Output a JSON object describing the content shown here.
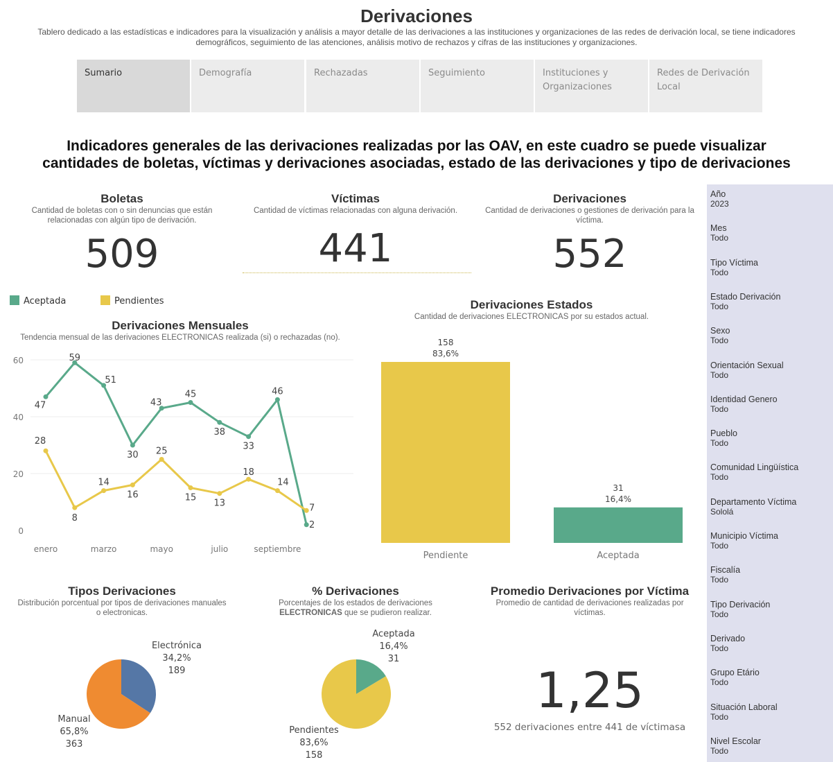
{
  "header": {
    "title": "Derivaciones",
    "subtitle_line1": "Tablero dedicado a las estadísticas e indicadores para la visualización y análisis a mayor detalle de las derivaciones a las instituciones y organizaciones de las redes de derivación local, se tiene indicadores",
    "subtitle_line2": "demográficos, seguimiento de las atenciones, análisis motivo de rechazos y cifras de las instituciones y organizaciones."
  },
  "tabs": [
    {
      "line1": "Sumario",
      "line2": "",
      "active": true
    },
    {
      "line1": "Demografía",
      "line2": ""
    },
    {
      "line1": "Rechazadas",
      "line2": ""
    },
    {
      "line1": "Seguimiento",
      "line2": ""
    },
    {
      "line1": "Instituciones y",
      "line2": "Organizaciones"
    },
    {
      "line1": "Redes de Derivación",
      "line2": "Local"
    }
  ],
  "section_heading": {
    "line1": "Indicadores generales de las derivaciones realizadas por las OAV, en este cuadro se puede visualizar",
    "line2": "cantidades de boletas, víctimas y derivaciones asociadas, estado de las derivaciones y tipo de derivaciones"
  },
  "kpis": {
    "boletas": {
      "title": "Boletas",
      "sub1": "Cantidad de boletas con o sin denuncias que están",
      "sub2": "relacionadas con algún tipo de derivación.",
      "value": "509"
    },
    "victimas": {
      "title": "Víctimas",
      "sub1": "Cantidad de víctimas relacionadas con alguna derivación.",
      "sub2": "",
      "value": "441"
    },
    "derivaciones": {
      "title": "Derivaciones",
      "sub1": "Cantidad de derivaciones o gestiones de derivación para la",
      "sub2": "víctima.",
      "value": "552"
    }
  },
  "legend": {
    "aceptada": "Aceptada",
    "pendientes": "Pendientes"
  },
  "colors": {
    "green": "#59a98a",
    "yellow": "#e8c84a",
    "blue": "#5577a6",
    "orange": "#ef8b31"
  },
  "monthly": {
    "title": "Derivaciones Mensuales",
    "sub": "Tendencia mensual de las derivaciones ELECTRONICAS realizada (si) o rechazadas (no)."
  },
  "estados": {
    "title": "Derivaciones Estados",
    "sub": "Cantidad de derivaciones ELECTRONICAS por su estados actual."
  },
  "tipos": {
    "title": "Tipos Derivaciones",
    "sub1": "Distribución porcentual por tipos de derivaciones manuales",
    "sub2": "o electronicas."
  },
  "porcentaje": {
    "title": "% Derivaciones",
    "sub1": "Porcentajes de los estados de derivaciones",
    "sub2_bold": "ELECTRONICAS",
    "sub2_rest": " que se pudieron realizar."
  },
  "promedio": {
    "title": "Promedio Derivaciones por Víctima",
    "sub1": "Promedio de cantidad de derivaciones realizadas por",
    "sub2": "víctimas.",
    "value": "1,25",
    "caption": "552 derivaciones entre 441 de víctimasa"
  },
  "filters": [
    {
      "label": "Año",
      "value": "2023"
    },
    {
      "label": "Mes",
      "value": "Todo"
    },
    {
      "label": "Tipo Víctima",
      "value": "Todo"
    },
    {
      "label": "Estado Derivación",
      "value": "Todo"
    },
    {
      "label": "Sexo",
      "value": "Todo"
    },
    {
      "label": "Orientación Sexual",
      "value": "Todo"
    },
    {
      "label": "Identidad Genero",
      "value": "Todo"
    },
    {
      "label": "Pueblo",
      "value": "Todo"
    },
    {
      "label": "Comunidad Lingüística",
      "value": "Todo"
    },
    {
      "label": "Departamento Víctima",
      "value": "Sololá"
    },
    {
      "label": "Municipio Víctima",
      "value": "Todo"
    },
    {
      "label": "Fiscalía",
      "value": "Todo"
    },
    {
      "label": "Tipo Derivación",
      "value": "Todo"
    },
    {
      "label": "Derivado",
      "value": "Todo"
    },
    {
      "label": "Grupo Etário",
      "value": "Todo"
    },
    {
      "label": "Situación Laboral",
      "value": "Todo"
    },
    {
      "label": "Nivel Escolar",
      "value": "Todo"
    }
  ],
  "chart_data": [
    {
      "type": "line",
      "title": "Derivaciones Mensuales",
      "x_tick_labels": [
        "enero",
        "marzo",
        "mayo",
        "julio",
        "septiembre"
      ],
      "x": [
        1,
        2,
        3,
        4,
        5,
        6,
        7,
        8,
        9,
        10
      ],
      "ylim": [
        0,
        60
      ],
      "yticks": [
        0,
        20,
        40,
        60
      ],
      "grid": true,
      "legend": "top-left",
      "series": [
        {
          "name": "Aceptada",
          "values": [
            47,
            59,
            51,
            30,
            43,
            45,
            38,
            33,
            46,
            2
          ]
        },
        {
          "name": "Pendientes",
          "values": [
            28,
            8,
            14,
            16,
            25,
            15,
            13,
            18,
            14,
            7
          ]
        }
      ]
    },
    {
      "type": "bar",
      "title": "Derivaciones Estados",
      "categories": [
        "Pendiente",
        "Aceptada"
      ],
      "values": [
        158,
        31
      ],
      "percent_labels": [
        "83,6%",
        "16,4%"
      ]
    },
    {
      "type": "pie",
      "title": "Tipos Derivaciones",
      "labels": [
        "Electrónica",
        "Manual"
      ],
      "values": [
        189,
        363
      ],
      "percent_labels": [
        "34,2%",
        "65,8%"
      ]
    },
    {
      "type": "pie",
      "title": "% Derivaciones",
      "labels": [
        "Aceptada",
        "Pendientes"
      ],
      "values": [
        31,
        158
      ],
      "percent_labels": [
        "16,4%",
        "83,6%"
      ]
    }
  ]
}
